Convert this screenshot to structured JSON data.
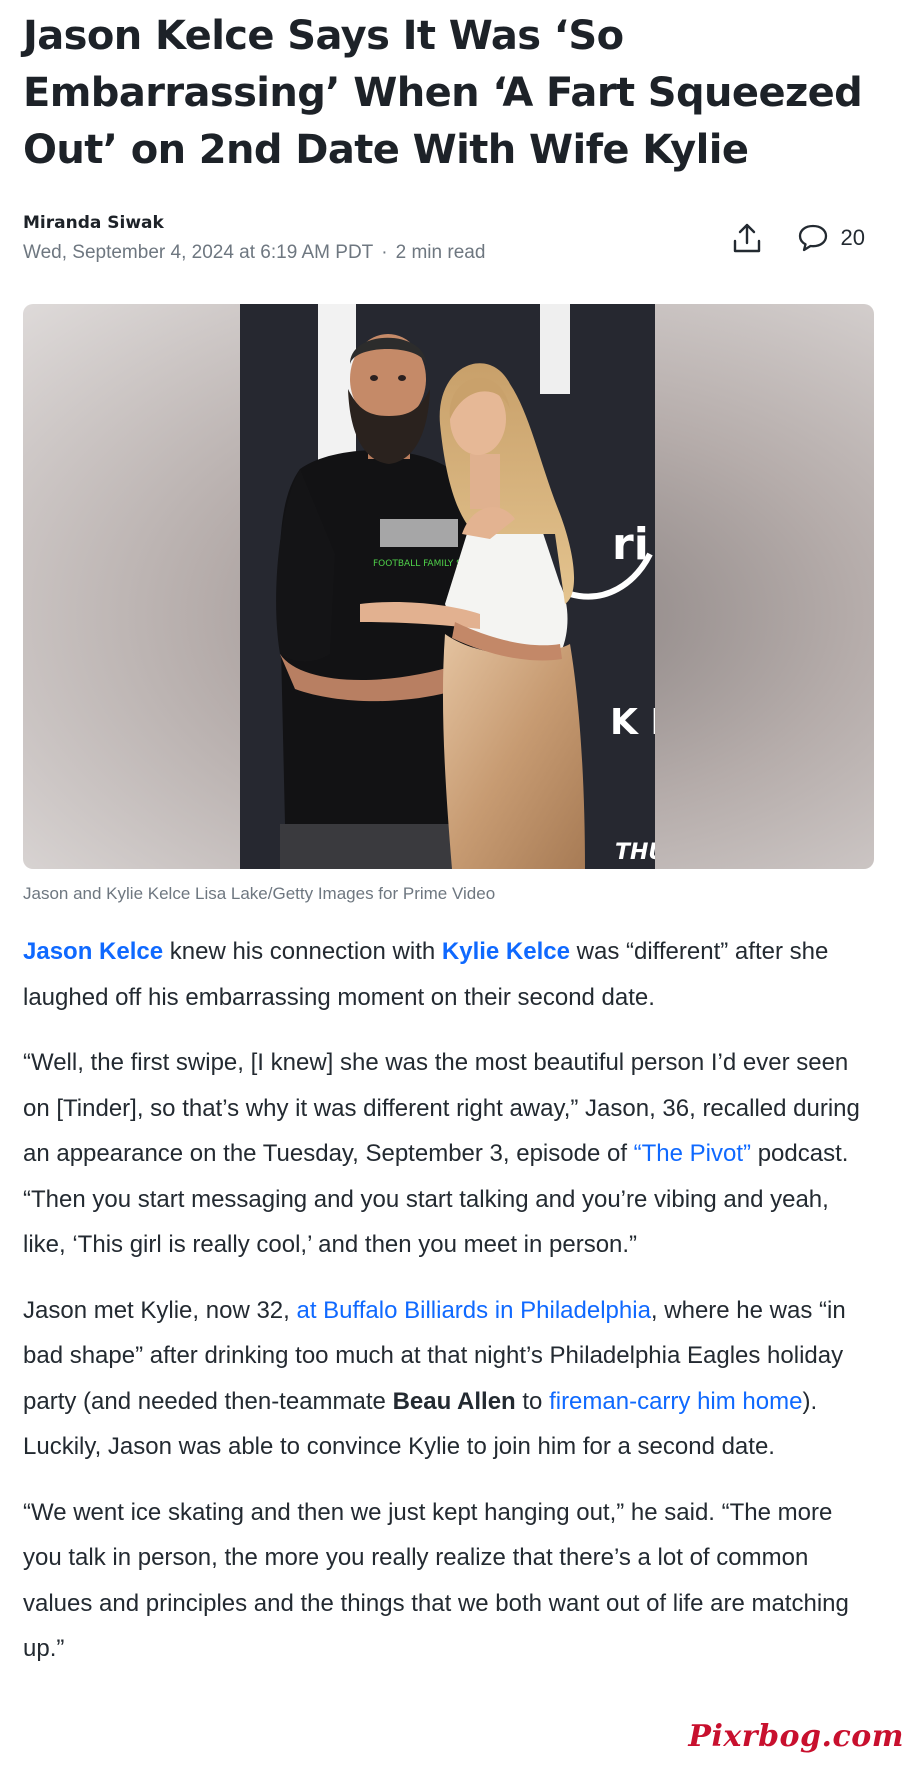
{
  "article": {
    "headline": "Jason Kelce Says It Was ‘So Embarrassing’ When ‘A Fart Squeezed Out’ on 2nd Date With Wife Kylie",
    "author": "Miranda Siwak",
    "date": "Wed, September 4, 2024 at 6:19 AM PDT",
    "separator": "·",
    "read_time": "2 min read",
    "comment_count": "20",
    "caption": "Jason and Kylie Kelce Lisa Lake/Getty Images for Prime Video",
    "photo_shirt_text": "FOOTBALL FAMILY ST",
    "photo_backdrop_text": "ri",
    "photo_backdrop_text2": "K E",
    "photo_backdrop_text3": "THU",
    "p1": {
      "link1": "Jason Kelce",
      "t1": " knew his connection with ",
      "link2": "Kylie Kelce",
      "t2": " was “different” after she laughed off his embarrassing moment on their second date."
    },
    "p2": {
      "t1": "“Well, the first swipe, [I knew] she was the most beautiful person I’d ever seen on [Tinder], so that’s why it was different right away,” Jason, 36, recalled during an appearance on the Tuesday, September 3, episode of ",
      "link1": "“The Pivot”",
      "t2": " podcast. “Then you start messaging and you start talking and you’re vibing and yeah, like, ‘This girl is really cool,’ and then you meet in person.”"
    },
    "p3": {
      "t1": "Jason met Kylie, now 32, ",
      "link1": "at Buffalo Billiards in Philadelphia",
      "t2": ", where he was “in bad shape” after drinking too much at that night’s Philadelphia Eagles holiday party (and needed then-teammate ",
      "bold1": "Beau Allen",
      "t3": " to ",
      "link2": "fireman-carry him home",
      "t4": "). Luckily, Jason was able to convince Kylie to join him for a second date."
    },
    "p4": {
      "t1": "“We went ice skating and then we just kept hanging out,” he said. “The more you talk in person, the more you really realize that there’s a lot of common values and principles  and the things that we both want out of life are matching up.”"
    }
  },
  "watermark": "Pixrbog.com",
  "icons": {
    "share": "share-icon",
    "comment": "comment-icon"
  },
  "colors": {
    "link": "#0f69ff",
    "text": "#232a31",
    "meta": "#6e7780",
    "watermark": "#c8102e"
  }
}
